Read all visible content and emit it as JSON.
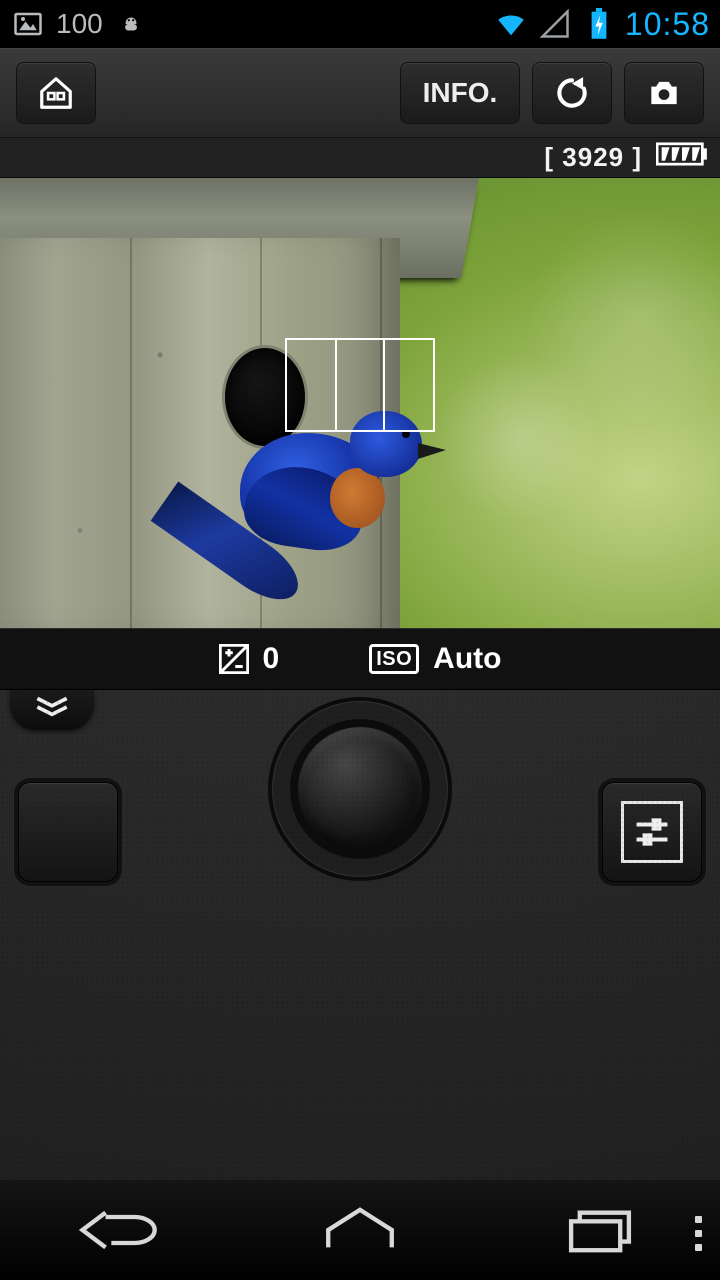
{
  "statusbar": {
    "battery_percent": "100",
    "clock": "10:58"
  },
  "appbar": {
    "info_label": "INFO."
  },
  "liveview": {
    "shots_remaining": "[ 3929 ]"
  },
  "settings": {
    "ev_label": "0",
    "iso_icon_text": "ISO",
    "iso_label": "Auto"
  }
}
